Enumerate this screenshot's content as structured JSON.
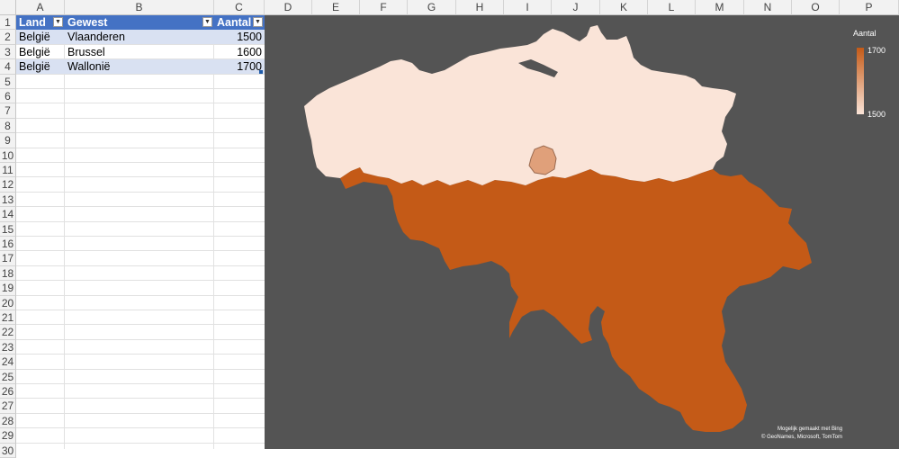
{
  "columns": [
    "A",
    "B",
    "C",
    "D",
    "E",
    "F",
    "G",
    "H",
    "I",
    "J",
    "K",
    "L",
    "M",
    "N",
    "O",
    "P"
  ],
  "rows": [
    "1",
    "2",
    "3",
    "4",
    "5",
    "6",
    "7",
    "8",
    "9",
    "10",
    "11",
    "12",
    "13",
    "14",
    "15",
    "16",
    "17",
    "18",
    "19",
    "20",
    "21",
    "22",
    "23",
    "24",
    "25",
    "26",
    "27",
    "28",
    "29",
    "30"
  ],
  "table": {
    "headers": [
      "Land",
      "Gewest",
      "Aantal"
    ],
    "rows": [
      [
        "België",
        "Vlaanderen",
        "1500"
      ],
      [
        "België",
        "Brussel",
        "1600"
      ],
      [
        "België",
        "Wallonië",
        "1700"
      ]
    ]
  },
  "map": {
    "legend_title": "Aantal",
    "legend_max": "1700",
    "legend_min": "1500",
    "credit_line1": "Mogelijk gemaakt met Bing",
    "credit_line2": "© GeoNames, Microsoft, TomTom",
    "colors": {
      "background": "#545454",
      "vlaanderen": "#fae4d8",
      "brussel": "#e0a07a",
      "wallonie": "#c45a17"
    }
  }
}
